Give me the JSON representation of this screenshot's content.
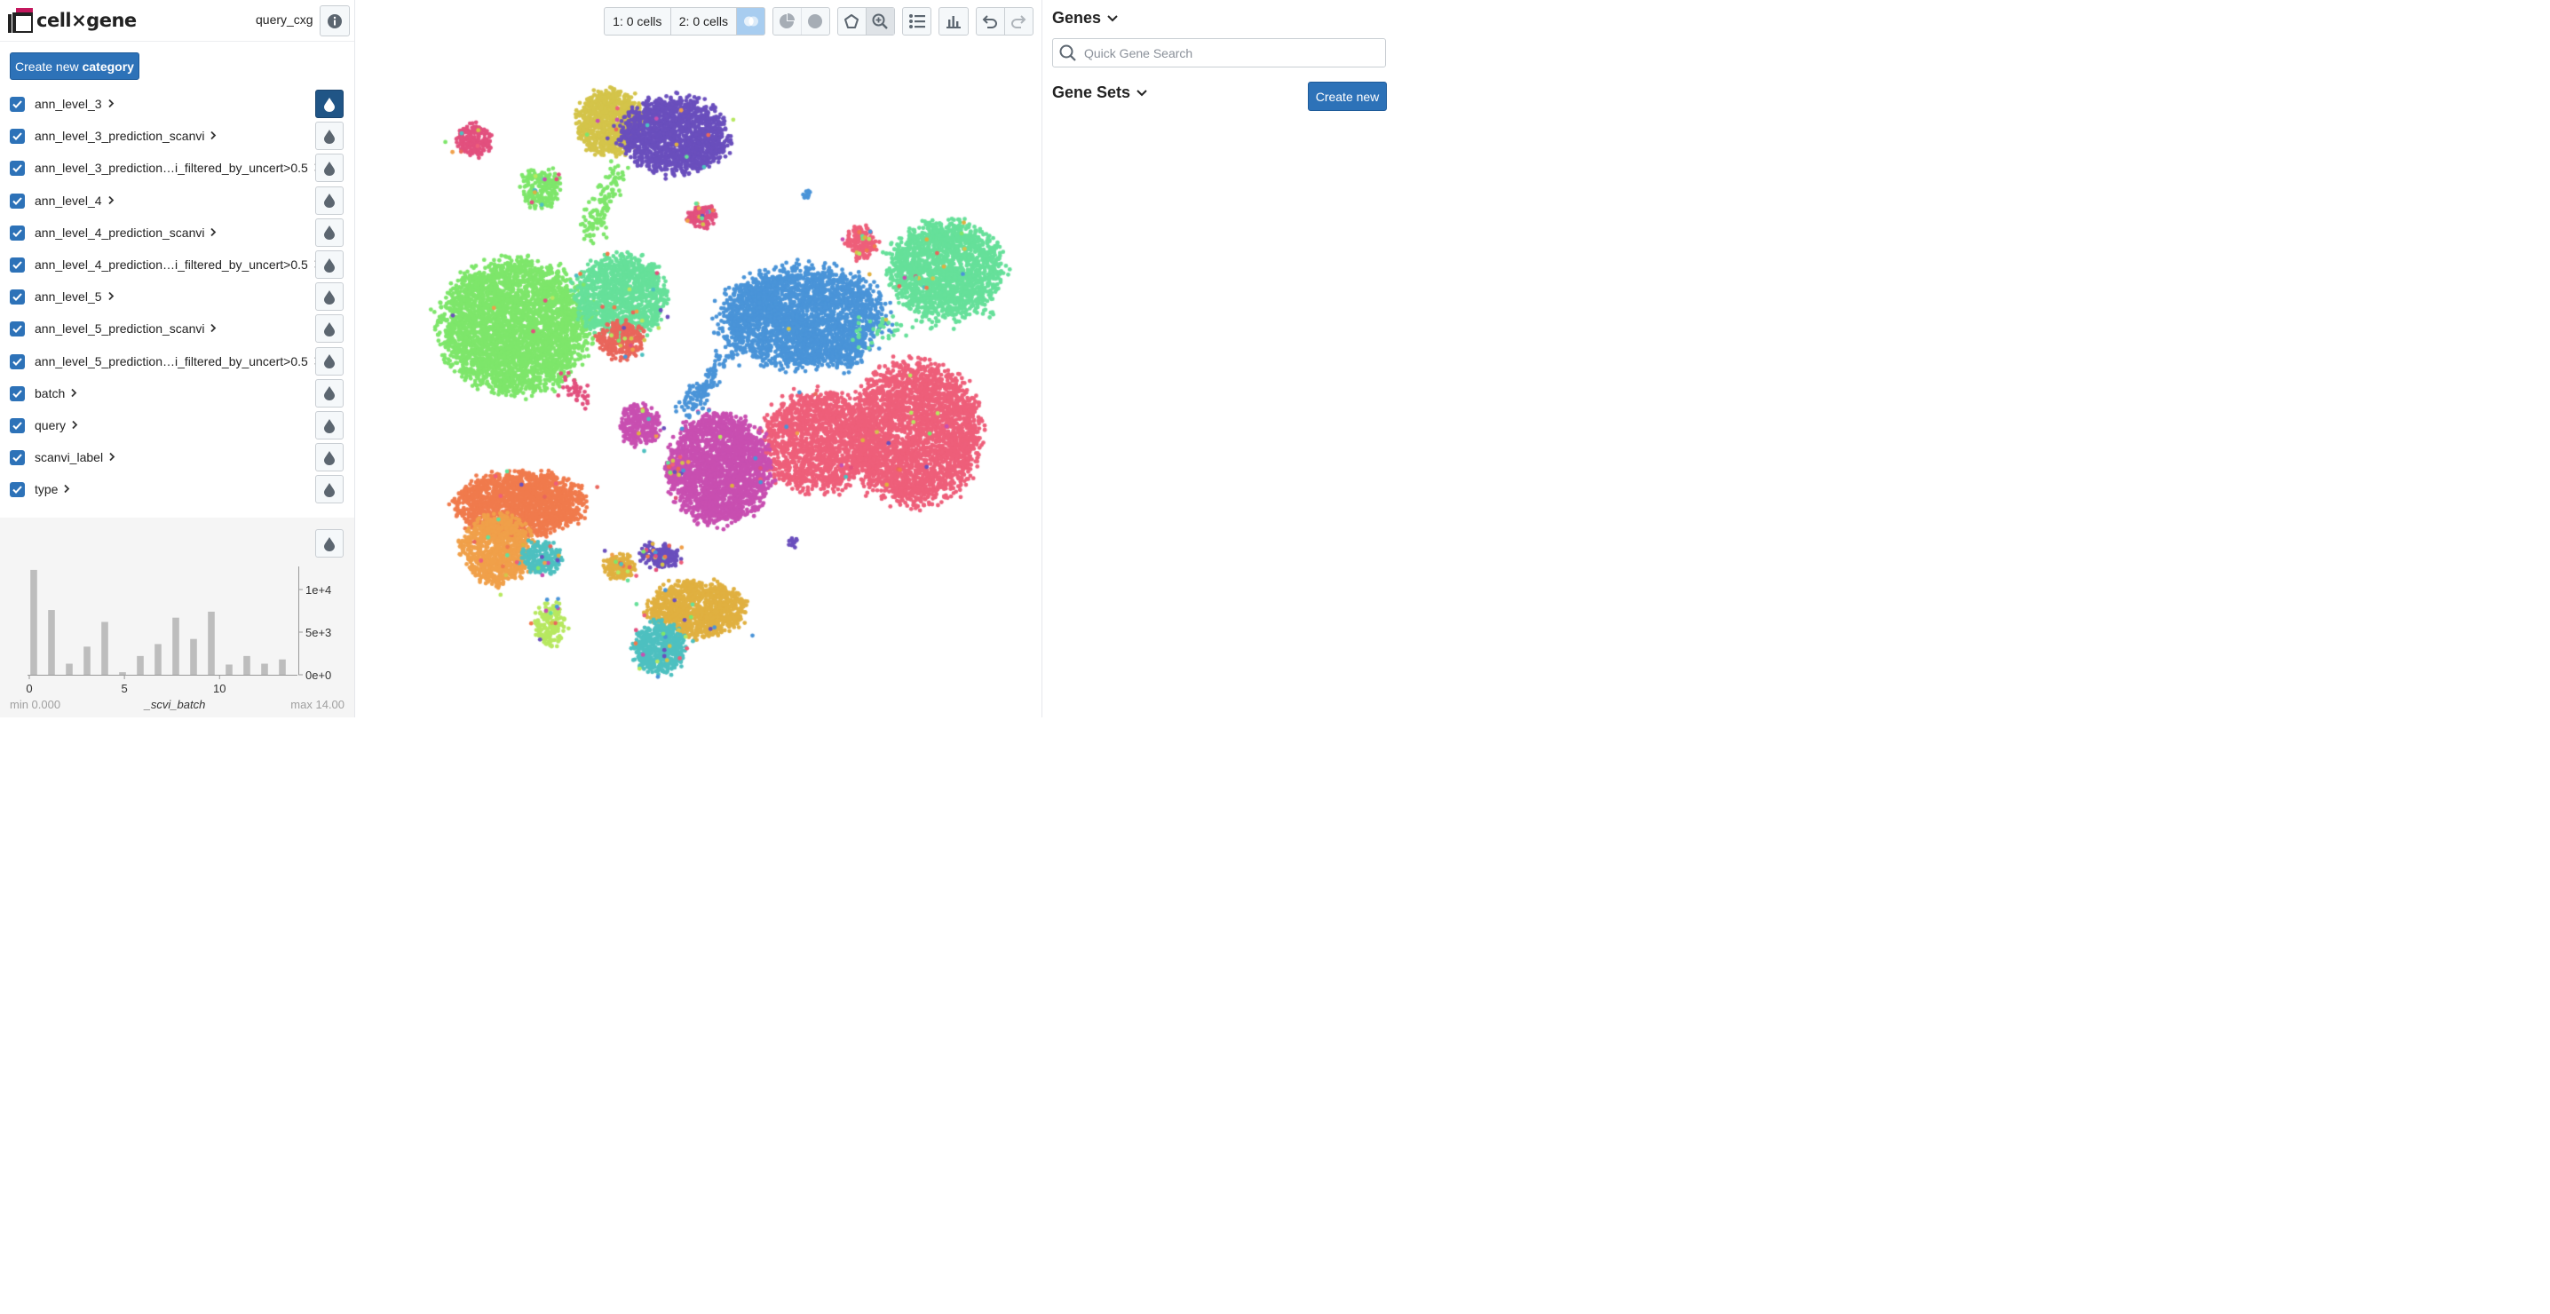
{
  "app": {
    "logo_text": "cell×gene",
    "dataset_name": "query_cxg"
  },
  "left": {
    "create_category_prefix": "Create new",
    "create_category_bold": "category",
    "categories": [
      {
        "label": "ann_level_3",
        "active": true
      },
      {
        "label": "ann_level_3_prediction_scanvi",
        "active": false
      },
      {
        "label": "ann_level_3_prediction…i_filtered_by_uncert>0.5",
        "active": false
      },
      {
        "label": "ann_level_4",
        "active": false
      },
      {
        "label": "ann_level_4_prediction_scanvi",
        "active": false
      },
      {
        "label": "ann_level_4_prediction…i_filtered_by_uncert>0.5",
        "active": false
      },
      {
        "label": "ann_level_5",
        "active": false
      },
      {
        "label": "ann_level_5_prediction_scanvi",
        "active": false
      },
      {
        "label": "ann_level_5_prediction…i_filtered_by_uncert>0.5",
        "active": false
      },
      {
        "label": "batch",
        "active": false
      },
      {
        "label": "query",
        "active": false
      },
      {
        "label": "scanvi_label",
        "active": false
      },
      {
        "label": "type",
        "active": false
      }
    ]
  },
  "histogram": {
    "field": "_scvi_batch",
    "min_label": "min 0.000",
    "max_label": "max 14.00",
    "x_ticks": [
      "0",
      "5",
      "10"
    ],
    "y_ticks": [
      "1e+4",
      "5e+3",
      "0e+0"
    ]
  },
  "chart_data": {
    "type": "bar",
    "title": "_scvi_batch",
    "x": [
      0,
      1,
      2,
      3,
      4,
      5,
      6,
      7,
      8,
      9,
      10,
      11,
      12,
      13,
      14
    ],
    "values": [
      12300,
      7600,
      1300,
      3300,
      6200,
      300,
      2200,
      3600,
      6700,
      4200,
      7400,
      1200,
      2200,
      1300,
      1800
    ],
    "xlim": [
      0,
      14
    ],
    "ylim": [
      0,
      12500
    ],
    "xlabel": "_scvi_batch",
    "ylabel": ""
  },
  "toolbar": {
    "selection1": "1: 0 cells",
    "selection2": "2: 0 cells"
  },
  "right": {
    "genes_header": "Genes",
    "search_placeholder": "Quick Gene Search",
    "gene_sets_header": "Gene Sets",
    "create_new_label": "Create new"
  },
  "colors": {
    "primary": "#2d72b8",
    "active_dark": "#205586",
    "clusters": [
      "#d4c44a",
      "#6a4fbd",
      "#e2507e",
      "#7ee66b",
      "#4a94d8",
      "#66e09a",
      "#ee5f7a",
      "#e9665c",
      "#c84fb1",
      "#f07b4d",
      "#f0a04a",
      "#4ec0c0",
      "#e0b040",
      "#b7e860"
    ]
  }
}
